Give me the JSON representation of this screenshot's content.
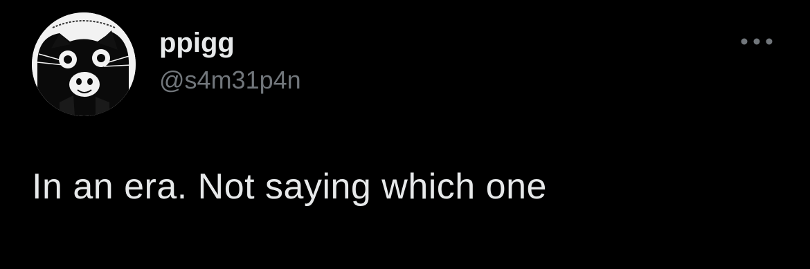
{
  "theme": {
    "background": "#000000",
    "primary_text": "#e7e9ea",
    "secondary_text": "#71767b"
  },
  "author": {
    "display_name": "ppigg",
    "handle": "@s4m31p4n",
    "avatar_icon": "black-cat-avatar"
  },
  "actions": {
    "more_icon": "more-horizontal-icon"
  },
  "tweet": {
    "text": "In an era. Not saying which one"
  }
}
